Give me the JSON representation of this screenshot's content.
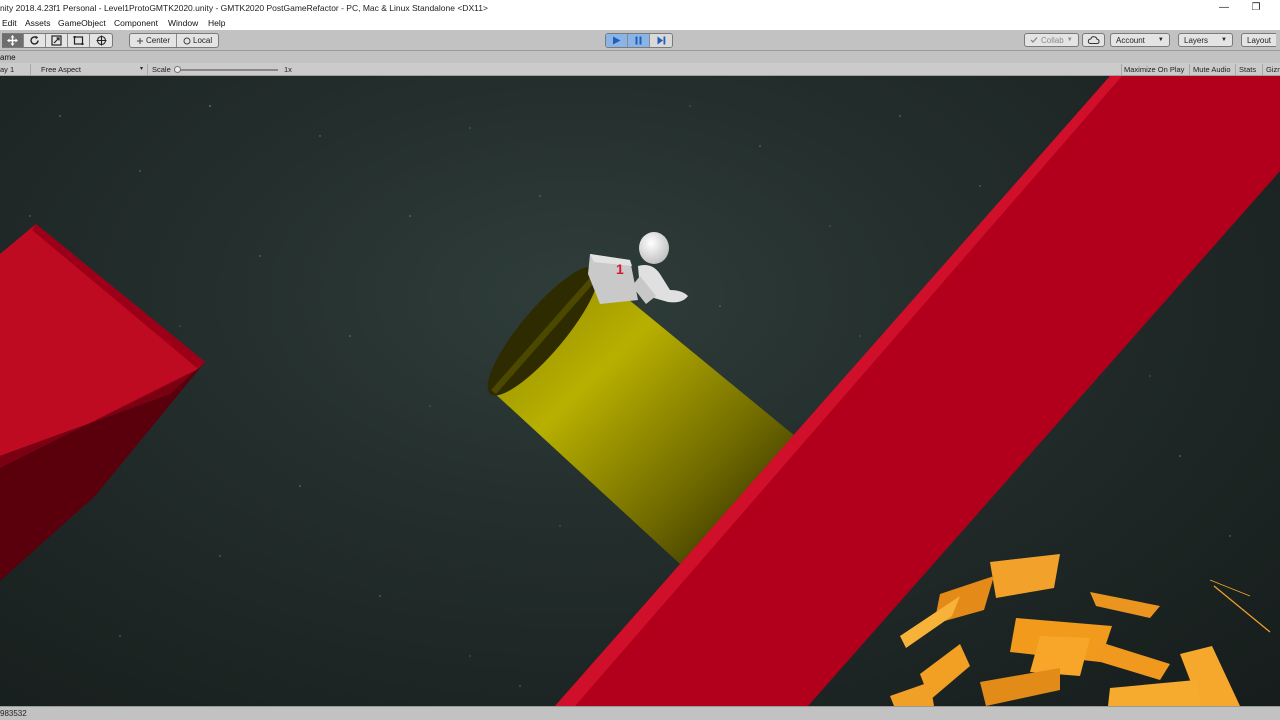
{
  "window": {
    "title": "nity 2018.4.23f1 Personal - Level1ProtoGMTK2020.unity - GMTK2020 PostGameRefactor - PC, Mac & Linux Standalone <DX11>",
    "minimize_glyph": "—",
    "restore_glyph": "❐"
  },
  "menu": {
    "items": [
      "Edit",
      "Assets",
      "GameObject",
      "Component",
      "Window",
      "Help"
    ]
  },
  "toolbar": {
    "pivot_center": "Center",
    "pivot_local": "Local",
    "collab": "Collab",
    "account": "Account",
    "layers": "Layers",
    "layout": "Layout"
  },
  "game_tab": {
    "label": "ame"
  },
  "game_bar": {
    "display": "ay 1",
    "aspect": "Free Aspect",
    "scale_label": "Scale",
    "scale_value": "1x",
    "scale_level": 0.0,
    "maximize_on_play": "Maximize On Play",
    "mute_audio": "Mute Audio",
    "stats": "Stats",
    "gizmos": "Gizm"
  },
  "scene": {
    "box_label": "1"
  },
  "status": {
    "text": "983532"
  },
  "colors": {
    "play_active": "#8ab4e6",
    "beam_red": "#a8001c",
    "platform_red": "#c0001e",
    "cylinder_yellow": "#b5ad00",
    "debris_orange": "#f29a1c"
  }
}
